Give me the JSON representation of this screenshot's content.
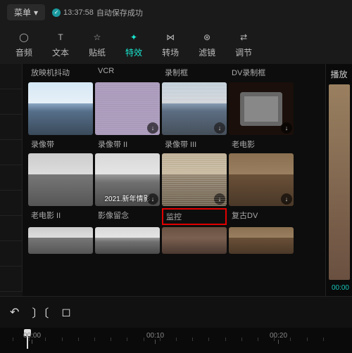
{
  "topbar": {
    "menu": "菜单",
    "time": "13:37:58",
    "status": "自动保存成功"
  },
  "tabs": [
    {
      "label": "音频",
      "icon": "◯"
    },
    {
      "label": "文本",
      "icon": "T"
    },
    {
      "label": "贴纸",
      "icon": "☆"
    },
    {
      "label": "特效",
      "icon": "✦",
      "active": true
    },
    {
      "label": "转场",
      "icon": "⋈"
    },
    {
      "label": "滤镜",
      "icon": "⊛"
    },
    {
      "label": "调节",
      "icon": "⇄"
    }
  ],
  "preview": {
    "label": "播放",
    "timecode": "00:00"
  },
  "header_row": [
    "放映机抖动",
    "VCR",
    "录制框",
    "DV录制框"
  ],
  "effects": [
    {
      "label": "录像带",
      "style": "mountain",
      "dl": false
    },
    {
      "label": "录像带 II",
      "style": "static",
      "dl": true
    },
    {
      "label": "录像带 III",
      "style": "scan-m",
      "dl": true
    },
    {
      "label": "老电影",
      "style": "tv",
      "dl": true
    },
    {
      "label": "老电影 II",
      "style": "bw",
      "dl": false
    },
    {
      "label": "影像留念",
      "style": "bw-m",
      "dl": true,
      "overlay": "2021.新年情影"
    },
    {
      "label": "监控",
      "style": "surv",
      "dl": true,
      "highlight": true
    },
    {
      "label": "复古DV",
      "style": "sep-m",
      "dl": true
    }
  ],
  "partial_row": [
    {
      "style": "bw"
    },
    {
      "style": "bw-m"
    },
    {
      "style": "sep"
    },
    {
      "style": "sep-m"
    }
  ],
  "timeline": {
    "marks": [
      "00:00",
      "00:10",
      "00:20"
    ]
  }
}
